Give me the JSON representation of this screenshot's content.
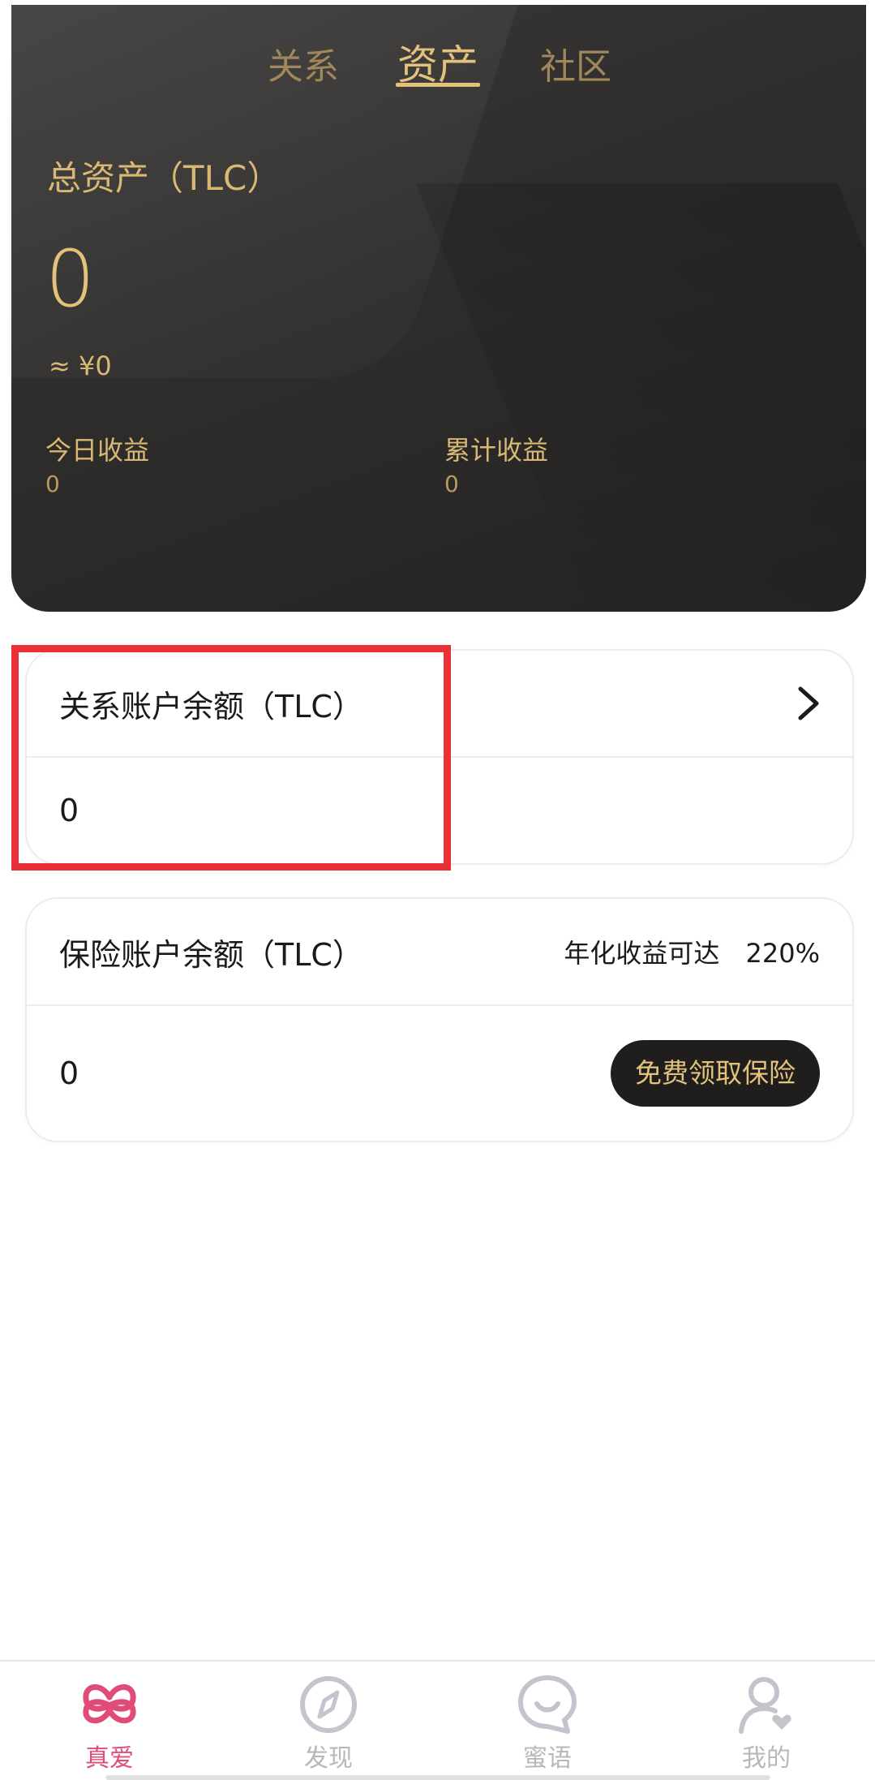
{
  "tabs": {
    "relation": "关系",
    "assets": "资产",
    "community": "社区"
  },
  "hero": {
    "total_label": "总资产（TLC）",
    "total_value": "0",
    "approx": "≈ ¥0",
    "today_label": "今日收益",
    "today_value": "0",
    "cumulative_label": "累计收益",
    "cumulative_value": "0"
  },
  "relation_card": {
    "title": "关系账户余额（TLC）",
    "balance": "0"
  },
  "insurance_card": {
    "title": "保险账户余额（TLC）",
    "yield_label": "年化收益可达",
    "yield_value": "220%",
    "balance": "0",
    "button": "免费领取保险"
  },
  "bottom_nav": {
    "items": [
      {
        "label": "真爱",
        "icon": "love-knot-icon"
      },
      {
        "label": "发现",
        "icon": "compass-icon"
      },
      {
        "label": "蜜语",
        "icon": "chat-smile-icon"
      },
      {
        "label": "我的",
        "icon": "profile-heart-icon"
      }
    ]
  },
  "colors": {
    "gold": "#e3c27c",
    "accent_pink": "#e04b77",
    "highlight_red": "#ea2f36",
    "hero_dark": "#2e2d2b"
  }
}
